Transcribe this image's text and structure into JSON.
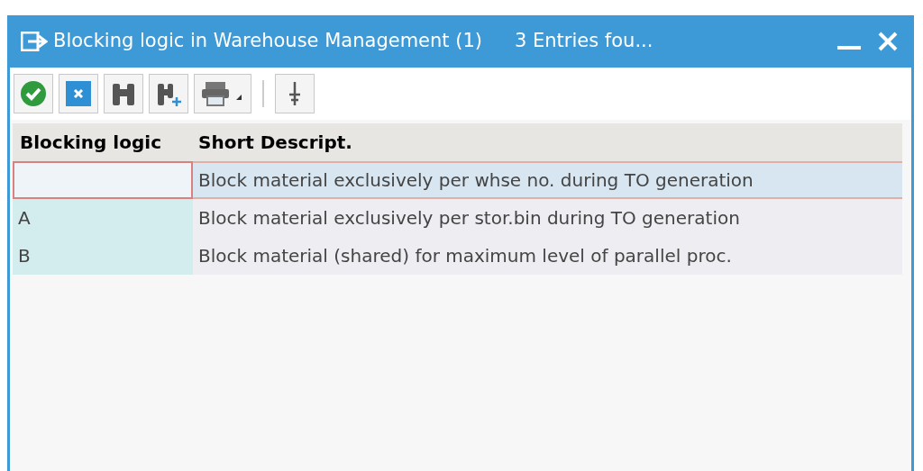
{
  "window": {
    "title": "Blocking logic in Warehouse Management (1)",
    "status": "3 Entries fou..."
  },
  "toolbar": [
    {
      "kind": "ok"
    },
    {
      "kind": "cancel"
    },
    {
      "kind": "find"
    },
    {
      "kind": "find-next"
    },
    {
      "kind": "print"
    },
    {
      "kind": "separator"
    },
    {
      "kind": "filter"
    }
  ],
  "table": {
    "columns": [
      "Blocking logic",
      "Short Descript."
    ],
    "rows": [
      {
        "description": "Block material exclusively per whse no. during TO generation",
        "selected": true
      },
      {
        "key": "A",
        "description": "Block material exclusively per stor.bin during TO generation",
        "selected": false
      },
      {
        "key": "B",
        "description": "Block material (shared) for maximum level of parallel proc.",
        "selected": false
      }
    ]
  }
}
